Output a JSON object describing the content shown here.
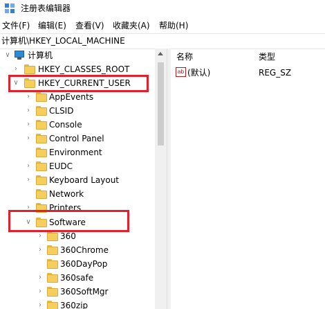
{
  "window": {
    "title": "注册表编辑器"
  },
  "menu": [
    "文件(F)",
    "编辑(E)",
    "查看(V)",
    "收藏夹(A)",
    "帮助(H)"
  ],
  "address": "计算机\\HKEY_LOCAL_MACHINE",
  "tree": {
    "root": "计算机",
    "hkcr": "HKEY_CLASSES_ROOT",
    "hkcu": "HKEY_CURRENT_USER",
    "hkcu_children": [
      "AppEvents",
      "CLSID",
      "Console",
      "Control Panel",
      "Environment",
      "EUDC",
      "Keyboard Layout",
      "Network",
      "Printers"
    ],
    "software": "Software",
    "software_children": [
      "360",
      "360Chrome",
      "360DayPop",
      "360safe",
      "360SoftMgr",
      "360zip"
    ]
  },
  "list": {
    "columns": [
      "名称",
      "类型"
    ],
    "rows": [
      {
        "name": "(默认)",
        "type": "REG_SZ",
        "icon": "ab"
      }
    ]
  },
  "colors": {
    "highlight": "#e0202a",
    "folder": "#f6ce5e"
  }
}
